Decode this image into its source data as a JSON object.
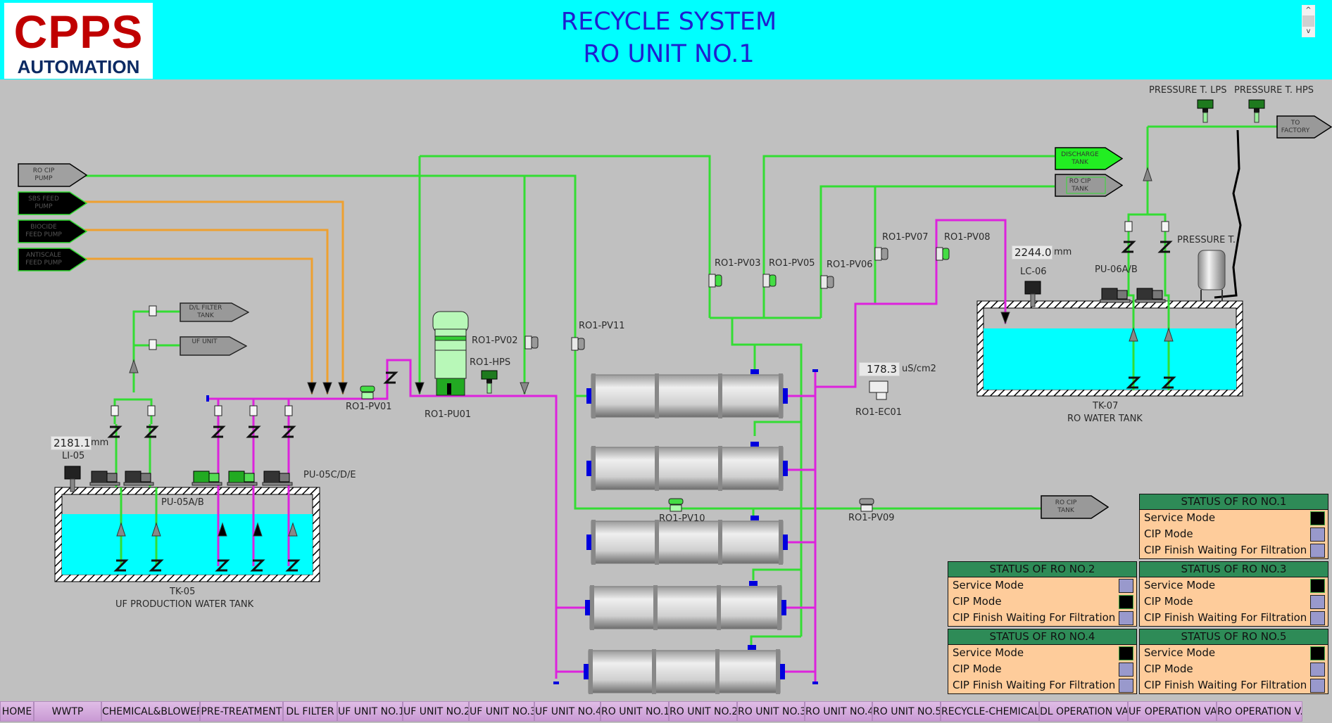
{
  "header": {
    "logo_top": "CPPS",
    "logo_bottom": "AUTOMATION",
    "title_line1": "RECYCLE SYSTEM",
    "title_line2": "RO UNIT NO.1",
    "scroll_up": "^",
    "scroll_down": "v"
  },
  "colors": {
    "header_bg": "#00ffff",
    "water": "#00ffff",
    "pipe_green": "#33dd33",
    "pipe_magenta": "#dd22dd",
    "pipe_orange": "#eea030",
    "status_header": "#2e8b57",
    "status_body": "#fecc9b",
    "indicator_on": "#000000",
    "indicator_off": "#9999cc"
  },
  "sources": [
    {
      "label": "RO CIP\nPUMP",
      "state": "gray"
    },
    {
      "label": "SBS FEED\nPUMP",
      "state": "black"
    },
    {
      "label": "BIOCIDE\nFEED PUMP",
      "state": "black"
    },
    {
      "label": "ANTISCALE\nFEED PUMP",
      "state": "black"
    }
  ],
  "destinations": {
    "dl_filter": "D/L FILTER\nTANK",
    "uf_unit": "UF UNIT",
    "discharge": "DISCHARGE\nTANK",
    "ro_cip_tank_top": "RO CIP\nTANK",
    "ro_cip_tank_mid": "RO CIP\nTANK",
    "to_factory": "TO\nFACTORY"
  },
  "tanks": {
    "tk05": {
      "id": "TK-05",
      "name": "UF PRODUCTION WATER TANK",
      "level_value": "2181.1",
      "level_unit": "mm",
      "level_tag": "LI-05",
      "pumps_ab": "PU-05A/B",
      "pumps_cde": "PU-05C/D/E"
    },
    "tk07": {
      "id": "TK-07",
      "name": "RO WATER TANK",
      "level_value": "2244.0",
      "level_unit": "mm",
      "level_tag": "LC-06",
      "pumps": "PU-06A/B",
      "pressure_tank": "PRESSURE T."
    }
  },
  "instruments": {
    "pt_lps": "PRESSURE T. LPS",
    "pt_hps": "PRESSURE T. HPS",
    "hps": "RO1-HPS",
    "pump": "RO1-PU01",
    "ec_tag": "RO1-EC01",
    "ec_value": "178.3",
    "ec_unit": "uS/cm2"
  },
  "valves": {
    "pv01": "RO1-PV01",
    "pv02": "RO1-PV02",
    "pv03": "RO1-PV03",
    "pv05": "RO1-PV05",
    "pv06": "RO1-PV06",
    "pv07": "RO1-PV07",
    "pv08": "RO1-PV08",
    "pv09": "RO1-PV09",
    "pv10": "RO1-PV10",
    "pv11": "RO1-PV11"
  },
  "status_panels": [
    {
      "title": "STATUS OF RO NO.1",
      "rows": [
        {
          "label": "Service Mode",
          "on": true
        },
        {
          "label": "CIP Mode",
          "on": false
        },
        {
          "label": "CIP Finish Waiting For Filtration",
          "on": false
        }
      ]
    },
    {
      "title": "STATUS OF RO NO.2",
      "rows": [
        {
          "label": "Service Mode",
          "on": false
        },
        {
          "label": "CIP Mode",
          "on": true
        },
        {
          "label": "CIP Finish Waiting For Filtration",
          "on": false
        }
      ]
    },
    {
      "title": "STATUS OF RO NO.3",
      "rows": [
        {
          "label": "Service Mode",
          "on": true
        },
        {
          "label": "CIP Mode",
          "on": false
        },
        {
          "label": "CIP Finish Waiting For Filtration",
          "on": false
        }
      ]
    },
    {
      "title": "STATUS OF RO NO.4",
      "rows": [
        {
          "label": "Service Mode",
          "on": true
        },
        {
          "label": "CIP Mode",
          "on": false
        },
        {
          "label": "CIP Finish Waiting For Filtration",
          "on": false
        }
      ]
    },
    {
      "title": "STATUS OF RO NO.5",
      "rows": [
        {
          "label": "Service Mode",
          "on": true
        },
        {
          "label": "CIP Mode",
          "on": false
        },
        {
          "label": "CIP Finish Waiting For Filtration",
          "on": false
        }
      ]
    }
  ],
  "nav": [
    "HOME",
    "WWTP",
    "CHEMICAL&BLOWER",
    "PRE-TREATMENT",
    "DL FILTER",
    "UF UNIT NO.1",
    "UF UNIT NO.2",
    "UF UNIT NO.3",
    "UF UNIT NO.4",
    "RO UNIT NO.1",
    "RO UNIT NO.2",
    "RO UNIT NO.3",
    "RO UNIT NO.4",
    "RO UNIT NO.5",
    "RECYCLE-CHEMICAL",
    "DL OPERATION VALVE",
    "UF OPERATION VALVE",
    "RO OPERATION V."
  ]
}
